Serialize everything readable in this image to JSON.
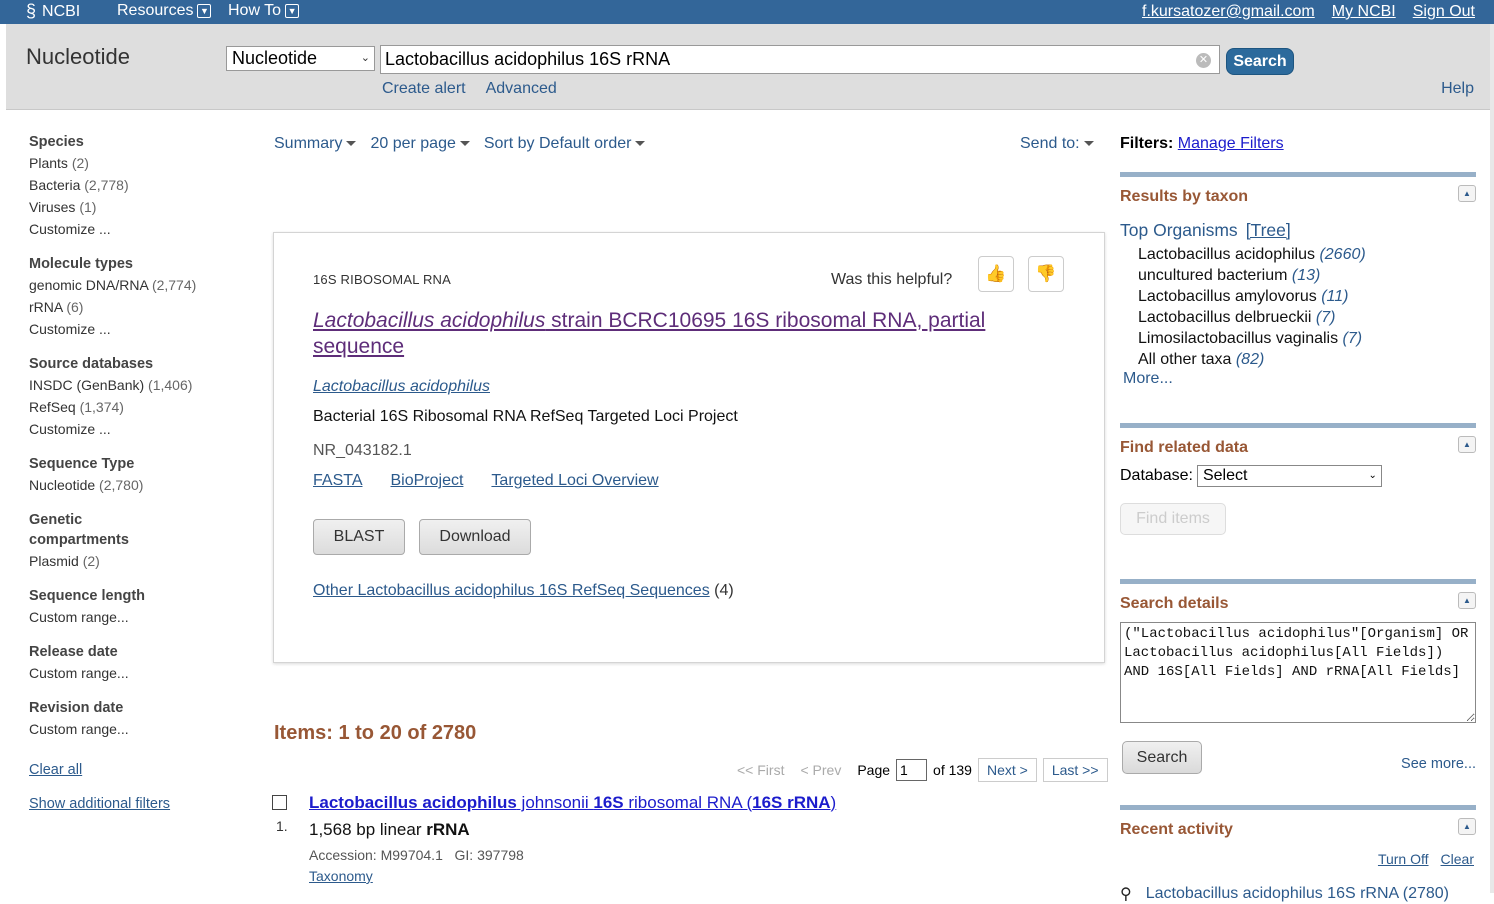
{
  "topbar": {
    "logo": "NCBI",
    "menus": [
      "Resources",
      "How To"
    ],
    "user_email": "f.kursatozer@gmail.com",
    "my_ncbi": "My NCBI",
    "sign_out": "Sign Out"
  },
  "search": {
    "db_title": "Nucleotide",
    "db_selected": "Nucleotide",
    "term": "Lactobacillus acidophilus 16S rRNA",
    "button": "Search",
    "create_alert": "Create alert",
    "advanced": "Advanced",
    "help": "Help"
  },
  "facets": [
    {
      "title": "Species",
      "items": [
        {
          "label": "Plants",
          "count": "(2)"
        },
        {
          "label": "Bacteria",
          "count": "(2,778)"
        },
        {
          "label": "Viruses",
          "count": "(1)"
        },
        {
          "label": "Customize ...",
          "count": ""
        }
      ]
    },
    {
      "title": "Molecule types",
      "items": [
        {
          "label": "genomic DNA/RNA",
          "count": "(2,774)"
        },
        {
          "label": "rRNA",
          "count": "(6)"
        },
        {
          "label": "Customize ...",
          "count": ""
        }
      ]
    },
    {
      "title": "Source databases",
      "items": [
        {
          "label": "INSDC (GenBank)",
          "count": "(1,406)"
        },
        {
          "label": "RefSeq",
          "count": "(1,374)"
        },
        {
          "label": "Customize ...",
          "count": ""
        }
      ]
    },
    {
      "title": "Sequence Type",
      "items": [
        {
          "label": "Nucleotide",
          "count": "(2,780)"
        }
      ]
    },
    {
      "title": "Genetic compartments",
      "items": [
        {
          "label": "Plasmid",
          "count": "(2)"
        }
      ]
    },
    {
      "title": "Sequence length",
      "items": [
        {
          "label": "Custom range...",
          "count": ""
        }
      ]
    },
    {
      "title": "Release date",
      "items": [
        {
          "label": "Custom range...",
          "count": ""
        }
      ]
    },
    {
      "title": "Revision date",
      "items": [
        {
          "label": "Custom range...",
          "count": ""
        }
      ]
    }
  ],
  "facet_links": {
    "clear_all": "Clear all",
    "show_additional": "Show additional filters"
  },
  "toolbar": {
    "summary": "Summary",
    "per_page": "20 per page",
    "sort": "Sort by Default order",
    "send_to": "Send to:"
  },
  "card": {
    "kicker": "16S RIBOSOMAL RNA",
    "helpful": "Was this helpful?",
    "title_italic": "Lactobacillus acidophilus",
    "title_rest": " strain BCRC10695 16S ribosomal RNA, partial sequence",
    "organism": "Lactobacillus acidophilus",
    "project": "Bacterial 16S Ribosomal RNA RefSeq Targeted Loci Project",
    "accession": "NR_043182.1",
    "links": [
      "FASTA",
      "BioProject",
      "Targeted Loci Overview"
    ],
    "blast": "BLAST",
    "download": "Download",
    "other_link": "Other Lactobacillus acidophilus 16S RefSeq Sequences",
    "other_count": " (4)"
  },
  "results": {
    "items_label": "Items: 1 to 20 of 2780",
    "pager": {
      "first": "<< First",
      "prev": "< Prev",
      "page_label": "Page",
      "page": "1",
      "of": "of 139",
      "next": "Next >",
      "last": "Last >>"
    },
    "first": {
      "num": "1.",
      "title_parts": [
        "Lactobacillus acidophilus",
        " johnsonii ",
        "16S",
        " ribosomal RNA (",
        "16S rRNA",
        ")"
      ],
      "desc_plain": "1,568 bp linear ",
      "desc_bold": "rRNA",
      "meta": "Accession: M99704.1   GI: 397798",
      "taxonomy": "Taxonomy"
    }
  },
  "right": {
    "filters_label": "Filters:",
    "manage_filters": "Manage Filters",
    "taxon": {
      "title": "Results by taxon",
      "top": "Top Organisms",
      "tree": "[Tree]",
      "organisms": [
        {
          "name": "Lactobacillus acidophilus",
          "count": "(2660)"
        },
        {
          "name": "uncultured bacterium",
          "count": "(13)"
        },
        {
          "name": "Lactobacillus amylovorus",
          "count": "(11)"
        },
        {
          "name": "Lactobacillus delbrueckii",
          "count": "(7)"
        },
        {
          "name": "Limosilactobacillus vaginalis",
          "count": "(7)"
        },
        {
          "name": "All other taxa",
          "count": "(82)"
        }
      ],
      "more": "More..."
    },
    "related": {
      "title": "Find related data",
      "database_label": "Database:",
      "select": "Select",
      "find": "Find items"
    },
    "details": {
      "title": "Search details",
      "query": "(\"Lactobacillus acidophilus\"[Organism] OR Lactobacillus acidophilus[All Fields]) AND 16S[All Fields] AND rRNA[All Fields]",
      "search": "Search",
      "see_more": "See more..."
    },
    "recent": {
      "title": "Recent activity",
      "turn_off": "Turn Off",
      "clear": "Clear",
      "item": "Lactobacillus acidophilus 16S rRNA (2780)"
    }
  }
}
